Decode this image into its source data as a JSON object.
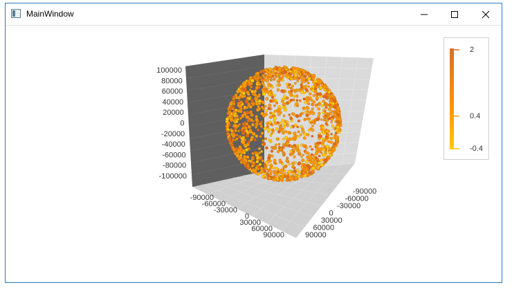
{
  "window": {
    "title": "MainWindow",
    "controls": {
      "minimize": "minimize-icon",
      "maximize": "maximize-icon",
      "close": "close-icon"
    }
  },
  "chart_data": {
    "type": "scatter",
    "title": "",
    "series": [],
    "axes": {
      "z_ticks": [
        "100000",
        "80000",
        "60000",
        "40000",
        "20000",
        "0",
        "-20000",
        "-40000",
        "-60000",
        "-80000",
        "-100000"
      ],
      "x_ticks": [
        "-90000",
        "-60000",
        "-30000",
        "0",
        "30000",
        "60000",
        "90000"
      ],
      "y_ticks": [
        "-90000",
        "-60000",
        "-30000",
        "0",
        "30000",
        "60000",
        "90000"
      ],
      "range": [
        -100000,
        100000
      ]
    },
    "shape": "sphere of points",
    "colors": {
      "low": "#ffcc00",
      "mid": "#ff9a00",
      "high": "#e06a1a",
      "back_wall": "#5f5f5f",
      "side_wall": "#d9d9d9",
      "floor": "#cfcfcf"
    }
  },
  "legend": {
    "labels": [
      "2",
      "0.4",
      "-0.4"
    ]
  }
}
